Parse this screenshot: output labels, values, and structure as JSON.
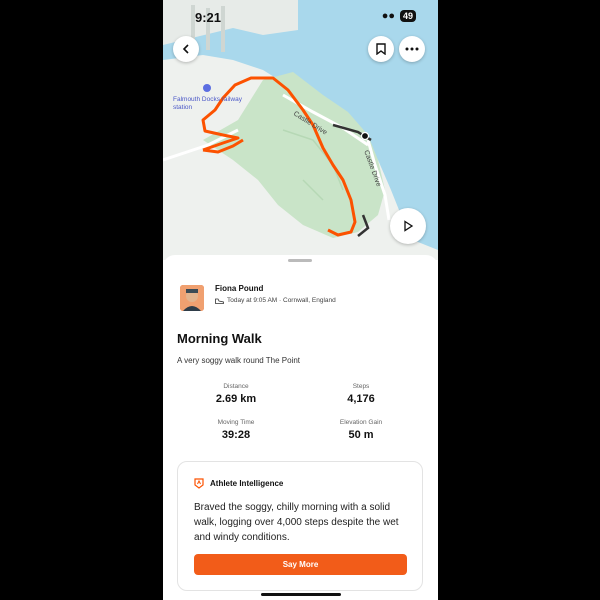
{
  "status_bar": {
    "time": "9:21",
    "battery": "49"
  },
  "map": {
    "labels": {
      "station": "Falmouth Docks railway station",
      "road1": "Castle Drive",
      "road2": "Castle Drive"
    },
    "colors": {
      "water": "#a9d8ec",
      "land": "#eef1ee",
      "park": "#c9e4c8",
      "route": "#fc5200",
      "road": "#333333"
    }
  },
  "activity": {
    "athlete_name": "Fiona Pound",
    "meta": "Today at 9:05 AM · Cornwall, England",
    "title": "Morning Walk",
    "description": "A very soggy walk round The Point",
    "stats": [
      {
        "label": "Distance",
        "value": "2.69 km"
      },
      {
        "label": "Steps",
        "value": "4,176"
      },
      {
        "label": "Moving Time",
        "value": "39:28"
      },
      {
        "label": "Elevation Gain",
        "value": "50 m"
      }
    ]
  },
  "ai": {
    "heading": "Athlete Intelligence",
    "text": "Braved the soggy, chilly morning with a solid walk, logging over 4,000 steps despite the wet and windy conditions.",
    "button": "Say More"
  },
  "accent": "#fc5200"
}
